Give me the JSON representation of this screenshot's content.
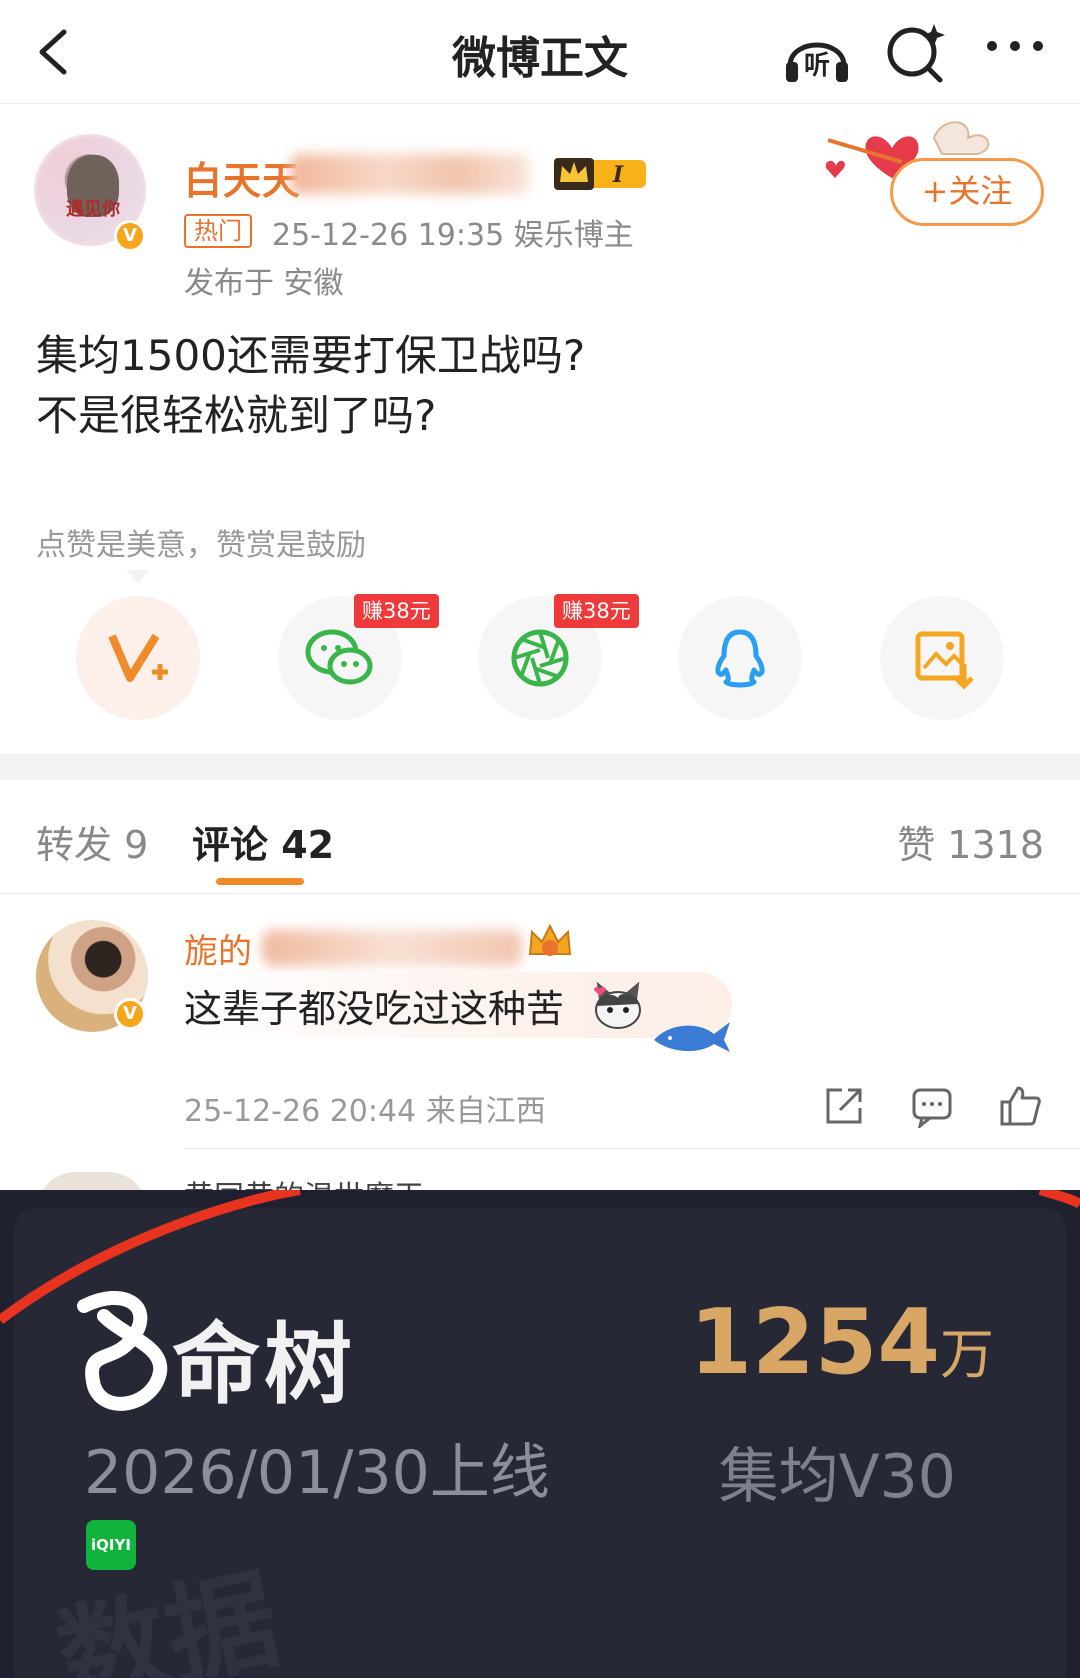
{
  "header": {
    "title": "微博正文",
    "listen_label": "听"
  },
  "post": {
    "author_visible": "白天天",
    "author_avatar_text": "遇见你",
    "verified_badge": "V",
    "level_badge": "I",
    "hot_tag": "热门",
    "meta": "25-12-26 19:35  娱乐博主",
    "location": "发布于 安徽",
    "follow_label": "+关注",
    "content_lines": [
      "集均1500还需要打保卫战吗?",
      "不是很轻松就到了吗?"
    ],
    "reward_hint": "点赞是美意，赞赏是鼓励",
    "share": [
      {
        "name": "weibo-reward",
        "earn": ""
      },
      {
        "name": "wechat",
        "earn": "赚38元"
      },
      {
        "name": "moments",
        "earn": "赚38元"
      },
      {
        "name": "qq",
        "earn": ""
      },
      {
        "name": "save-image",
        "earn": ""
      }
    ],
    "accent": "#e8742c"
  },
  "tabs": {
    "repost": "转发 9",
    "comments": "评论 42",
    "likes": "赞 1318"
  },
  "comments": [
    {
      "author_visible": "旎的",
      "text": "这辈子都没吃过这种苦",
      "meta": "25-12-26 20:44 来自江西"
    }
  ],
  "next_comment_peek": "黄同黄的温世魔王",
  "overlay": {
    "title": "命树",
    "date": "2026/01/30上线",
    "platform": "iQIYI",
    "number": "1254",
    "unit": "万",
    "average": "集均V30",
    "watermark": "数据"
  }
}
